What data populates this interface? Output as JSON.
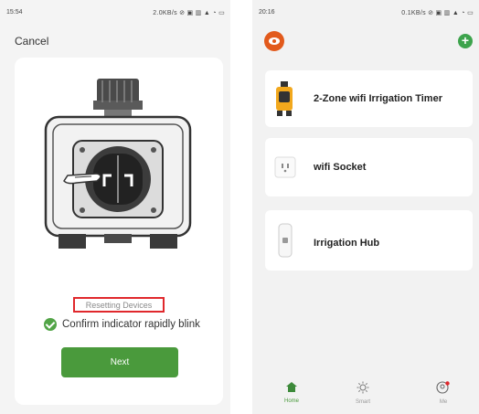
{
  "left_screen": {
    "status": {
      "time": "15:54",
      "icons": "2.0KB/s ⊘ ▣ ▥ ▲ ◔ ▭"
    },
    "cancel_label": "Cancel",
    "resetting_label": "Resetting Devices",
    "confirm_text": "Confirm indicator rapidly blink",
    "next_label": "Next"
  },
  "right_screen": {
    "status": {
      "time": "20:16",
      "icons": "0.1KB/s ⊘ ▣ ▥ ▲ ◔ ▭"
    },
    "devices": [
      {
        "name": "2-Zone wifi Irrigation Timer",
        "icon": "irrigation-timer-icon"
      },
      {
        "name": "wifi Socket",
        "icon": "socket-icon"
      },
      {
        "name": "Irrigation Hub",
        "icon": "hub-icon"
      }
    ],
    "tabs": [
      {
        "label": "Home",
        "icon": "home-icon"
      },
      {
        "label": "Smart",
        "icon": "sun-icon"
      },
      {
        "label": "Me",
        "icon": "me-icon"
      }
    ]
  },
  "colors": {
    "accent_green": "#4a9a3c",
    "highlight_red": "#e0282c",
    "avatar_orange": "#e25a1c"
  }
}
